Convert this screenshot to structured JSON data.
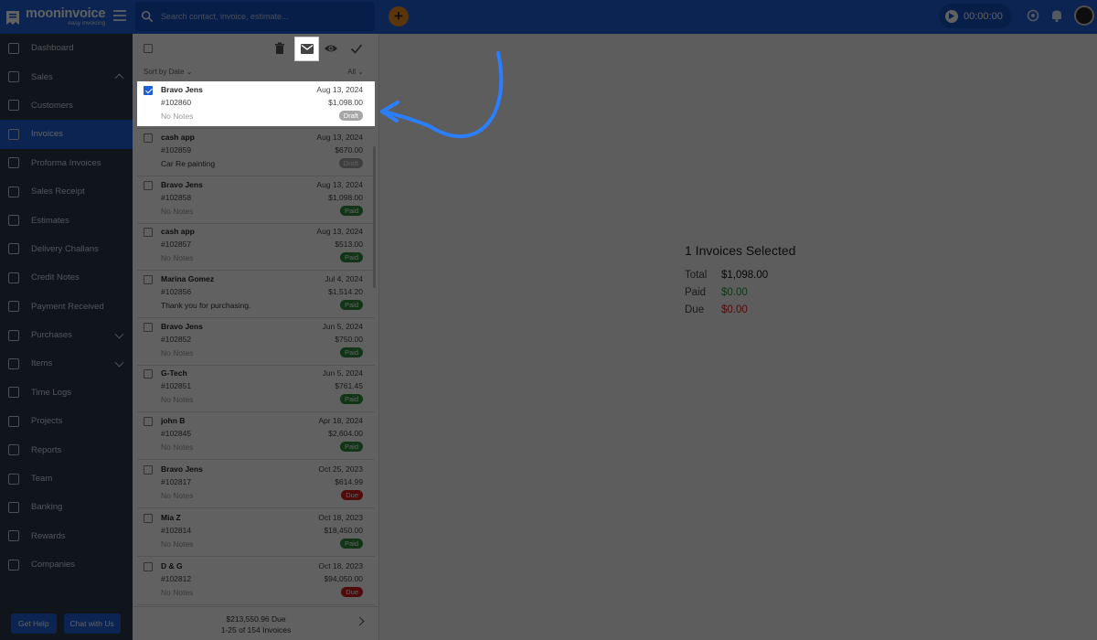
{
  "app": {
    "name": "mooninvoice",
    "tagline": "easy invoicing"
  },
  "search": {
    "placeholder": "Search contact, invoice, estimate..."
  },
  "timer": {
    "value": "00:00:00"
  },
  "sidebar": {
    "items": [
      {
        "label": "Dashboard",
        "name": "dashboard"
      },
      {
        "label": "Sales",
        "name": "sales"
      },
      {
        "label": "Customers",
        "name": "customers"
      },
      {
        "label": "Invoices",
        "name": "invoices"
      },
      {
        "label": "Proforma Invoices",
        "name": "proforma-invoices"
      },
      {
        "label": "Sales Receipt",
        "name": "sales-receipt"
      },
      {
        "label": "Estimates",
        "name": "estimates"
      },
      {
        "label": "Delivery Challans",
        "name": "delivery-challans"
      },
      {
        "label": "Credit Notes",
        "name": "credit-notes"
      },
      {
        "label": "Payment Received",
        "name": "payment-received"
      },
      {
        "label": "Purchases",
        "name": "purchases"
      },
      {
        "label": "Items",
        "name": "items"
      },
      {
        "label": "Time Logs",
        "name": "time-logs"
      },
      {
        "label": "Projects",
        "name": "projects"
      },
      {
        "label": "Reports",
        "name": "reports"
      },
      {
        "label": "Team",
        "name": "team"
      },
      {
        "label": "Banking",
        "name": "banking"
      },
      {
        "label": "Rewards",
        "name": "rewards"
      },
      {
        "label": "Companies",
        "name": "companies"
      }
    ],
    "active": "Invoices",
    "help_label": "Get Help",
    "chat_label": "Chat with Us"
  },
  "list": {
    "sort_label": "Sort by Date",
    "filter_label": "All",
    "rows": [
      {
        "name": "Bravo Jens",
        "number": "#102860",
        "note": "No Notes",
        "date": "Aug 13, 2024",
        "amount": "$1,098.00",
        "status": "Draft",
        "checked": true
      },
      {
        "name": "cash app",
        "number": "#102859",
        "note": "Car Re painting",
        "date": "Aug 13, 2024",
        "amount": "$670.00",
        "status": "Draft",
        "checked": false
      },
      {
        "name": "Bravo Jens",
        "number": "#102858",
        "note": "No Notes",
        "date": "Aug 13, 2024",
        "amount": "$1,098.00",
        "status": "Paid",
        "checked": false
      },
      {
        "name": "cash app",
        "number": "#102857",
        "note": "No Notes",
        "date": "Aug 13, 2024",
        "amount": "$513.00",
        "status": "Paid",
        "checked": false
      },
      {
        "name": "Marina Gomez",
        "number": "#102856",
        "note": "Thank you for purchasing.",
        "date": "Jul 4, 2024",
        "amount": "$1,514.20",
        "status": "Paid",
        "checked": false
      },
      {
        "name": "Bravo Jens",
        "number": "#102852",
        "note": "No Notes",
        "date": "Jun 5, 2024",
        "amount": "$750.00",
        "status": "Paid",
        "checked": false
      },
      {
        "name": "G-Tech",
        "number": "#102851",
        "note": "No Notes",
        "date": "Jun 5, 2024",
        "amount": "$761.45",
        "status": "Paid",
        "checked": false
      },
      {
        "name": "john B",
        "number": "#102845",
        "note": "No Notes",
        "date": "Apr 18, 2024",
        "amount": "$2,604.00",
        "status": "Paid",
        "checked": false
      },
      {
        "name": "Bravo Jens",
        "number": "#102817",
        "note": "No Notes",
        "date": "Oct 25, 2023",
        "amount": "$614.99",
        "status": "Due",
        "checked": false
      },
      {
        "name": "Mia Z",
        "number": "#102814",
        "note": "No Notes",
        "date": "Oct 18, 2023",
        "amount": "$18,450.00",
        "status": "Paid",
        "checked": false
      },
      {
        "name": "D & G",
        "number": "#102812",
        "note": "No Notes",
        "date": "Oct 18, 2023",
        "amount": "$94,050.00",
        "status": "Due",
        "checked": false
      }
    ],
    "footer": {
      "due": "$213,550.96  Due",
      "range": "1-25 of 154 Invoices"
    }
  },
  "summary": {
    "title": "1 Invoices Selected",
    "total_label": "Total",
    "total": "$1,098.00",
    "paid_label": "Paid",
    "paid": "$0.00",
    "due_label": "Due",
    "due": "$0.00"
  },
  "colors": {
    "brand": "#1e60d4",
    "sidebar": "#2b3849",
    "paid": "#2e8b3a",
    "due": "#d11f1f",
    "draft": "#a5a5a5",
    "arrow": "#2a7fff"
  }
}
